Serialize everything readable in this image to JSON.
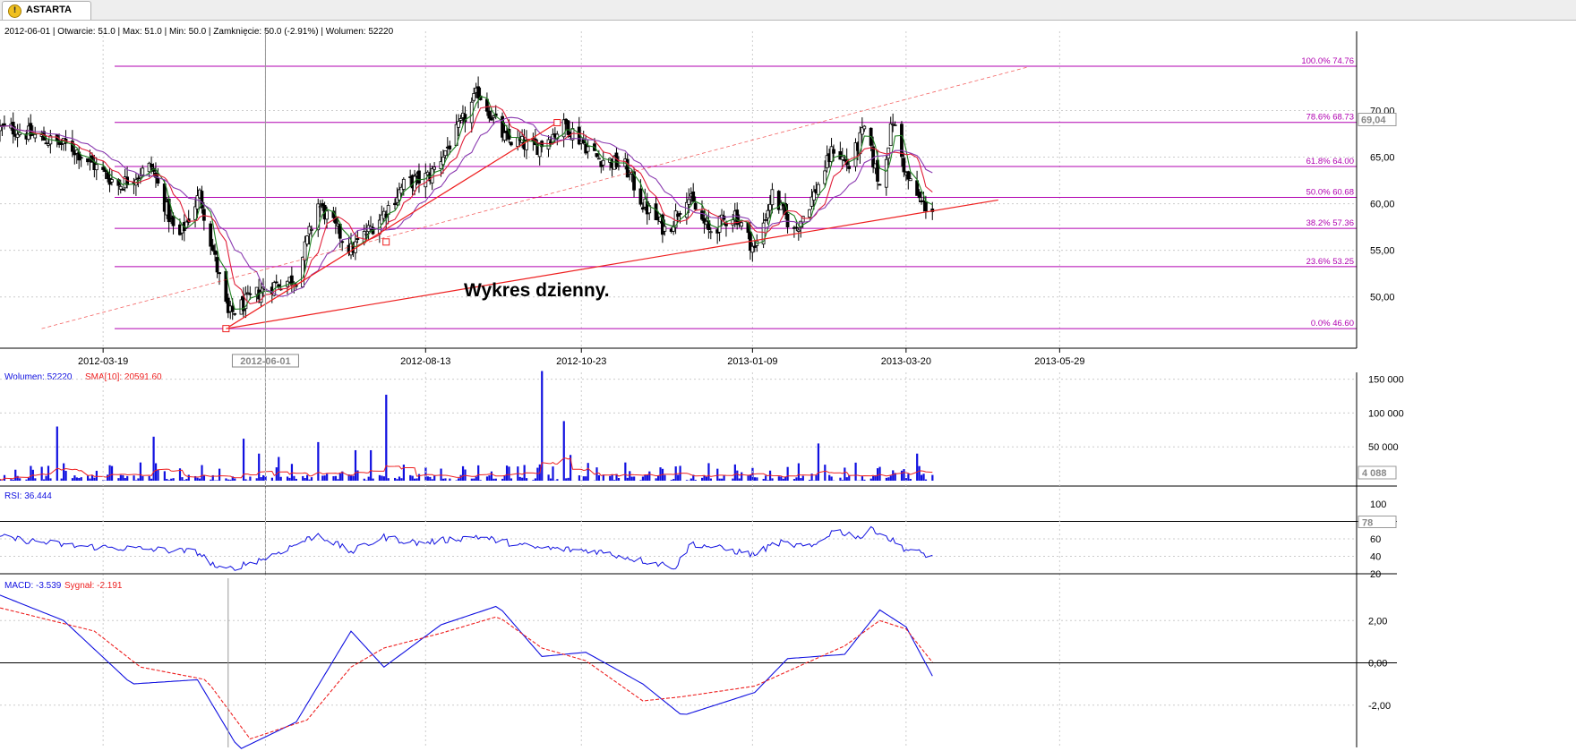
{
  "tab": {
    "label": "ASTARTA",
    "icon": "warning-icon"
  },
  "info_line": "2012-06-01 | Otwarcie: 51.0 | Max: 51.0 | Min: 50.0 | Zamknięcie: 50.0 (-2.91%) | Wolumen: 52220",
  "annotation": "Wykres dzienny.",
  "colors": {
    "candle": "#000000",
    "sma_fast": "#208020",
    "sma_mid": "#e0203a",
    "sma_slow": "#8a3ab0",
    "fib": "#b000b0",
    "trend": "#ee2020",
    "volume": "#1010e0",
    "rsi": "#1010e0",
    "macd": "#1010e0",
    "signal": "#ee2020"
  },
  "chart_data": [
    {
      "type": "candlestick",
      "panel": "price",
      "ylim": [
        44.5,
        78.5
      ],
      "xlim": [
        "2012-02-01",
        "2013-06-01"
      ],
      "x_ticks": [
        "2012-03-19",
        "2012-06-01",
        "2012-08-13",
        "2012-10-23",
        "2013-01-09",
        "2013-03-20",
        "2013-05-29"
      ],
      "y_ticks": [
        "50,00",
        "55,00",
        "60,00",
        "65,00",
        "70,00"
      ],
      "last_price_marker": "69,04",
      "fibonacci": [
        {
          "label": "100.0% 74.76",
          "value": 74.76
        },
        {
          "label": "78.6% 68.73",
          "value": 68.73
        },
        {
          "label": "61.8% 64.00",
          "value": 64.0
        },
        {
          "label": "50.0% 60.68",
          "value": 60.68
        },
        {
          "label": "38.2% 57.36",
          "value": 57.36
        },
        {
          "label": "23.6% 53.25",
          "value": 53.25
        },
        {
          "label": "0.0% 46.60",
          "value": 46.6
        }
      ],
      "trendlines": [
        {
          "from": [
            "2012-05-14",
            46.6
          ],
          "to": [
            "2012-10-12",
            68.7
          ],
          "handles": [
            [
              "2012-05-14",
              46.6
            ],
            [
              "2012-07-26",
              55.9
            ],
            [
              "2012-10-12",
              68.7
            ]
          ]
        },
        {
          "from": [
            "2012-05-14",
            46.6
          ],
          "to": [
            "2013-05-01",
            60.4
          ]
        },
        {
          "from": [
            "2012-02-20",
            46.6
          ],
          "to": [
            "2013-05-15",
            74.7
          ],
          "dashed": true
        }
      ],
      "anchors": [
        [
          "2012-02-07",
          68
        ],
        [
          "2012-03-05",
          66
        ],
        [
          "2012-03-26",
          62
        ],
        [
          "2012-04-10",
          64
        ],
        [
          "2012-04-22",
          56
        ],
        [
          "2012-05-02",
          61
        ],
        [
          "2012-05-15",
          48
        ],
        [
          "2012-06-01",
          51
        ],
        [
          "2012-06-15",
          52
        ],
        [
          "2012-06-25",
          60
        ],
        [
          "2012-07-10",
          55
        ],
        [
          "2012-07-25",
          59
        ],
        [
          "2012-08-03",
          62
        ],
        [
          "2012-08-15",
          63
        ],
        [
          "2012-08-28",
          68
        ],
        [
          "2012-09-06",
          72
        ],
        [
          "2012-09-18",
          67
        ],
        [
          "2012-10-02",
          66
        ],
        [
          "2012-10-16",
          68.5
        ],
        [
          "2012-10-30",
          65
        ],
        [
          "2012-11-12",
          64
        ],
        [
          "2012-11-20",
          60
        ],
        [
          "2012-12-01",
          57
        ],
        [
          "2012-12-10",
          61
        ],
        [
          "2012-12-20",
          57
        ],
        [
          "2013-01-01",
          59
        ],
        [
          "2013-01-10",
          55
        ],
        [
          "2013-01-18",
          61
        ],
        [
          "2013-01-28",
          57
        ],
        [
          "2013-02-06",
          61
        ],
        [
          "2013-02-15",
          66
        ],
        [
          "2013-02-22",
          64
        ],
        [
          "2013-03-01",
          68
        ],
        [
          "2013-03-08",
          62
        ],
        [
          "2013-03-14",
          69
        ],
        [
          "2013-03-20",
          63
        ],
        [
          "2013-03-27",
          60
        ],
        [
          "2013-04-01",
          59.5
        ]
      ]
    },
    {
      "type": "bar",
      "panel": "volume",
      "legend": [
        {
          "text": "Wolumen: 52220",
          "color": "#1010e0"
        },
        {
          "text": "SMA[10]: 20591.60",
          "color": "#ee2020"
        }
      ],
      "ylim": [
        0,
        160000
      ],
      "y_ticks": [
        "50 000",
        "100 000",
        "150 000"
      ],
      "last_marker": "4 088",
      "spikes": [
        [
          "2012-02-27",
          80000
        ],
        [
          "2012-04-11",
          65000
        ],
        [
          "2012-05-22",
          62000
        ],
        [
          "2012-05-29",
          40000
        ],
        [
          "2012-06-07",
          35000
        ],
        [
          "2012-06-25",
          57000
        ],
        [
          "2012-07-12",
          45000
        ],
        [
          "2012-07-26",
          127000
        ],
        [
          "2012-07-19",
          45000
        ],
        [
          "2012-10-05",
          162000
        ],
        [
          "2012-10-15",
          88000
        ],
        [
          "2012-10-18",
          38000
        ],
        [
          "2013-01-06",
          45000
        ],
        [
          "2013-02-08",
          55000
        ],
        [
          "2013-03-25",
          40000
        ]
      ]
    },
    {
      "type": "line",
      "panel": "rsi",
      "legend": [
        {
          "text": "RSI: 36.444",
          "color": "#1010e0"
        }
      ],
      "ylim": [
        20,
        100
      ],
      "y_ticks": [
        "20",
        "40",
        "60",
        "80",
        "100"
      ],
      "last_marker": "78",
      "anchors": [
        [
          "2012-02-01",
          62
        ],
        [
          "2012-03-05",
          52
        ],
        [
          "2012-04-10",
          48
        ],
        [
          "2012-05-01",
          45
        ],
        [
          "2012-05-12",
          23
        ],
        [
          "2012-06-01",
          38
        ],
        [
          "2012-06-25",
          65
        ],
        [
          "2012-07-10",
          45
        ],
        [
          "2012-07-25",
          62
        ],
        [
          "2012-08-10",
          55
        ],
        [
          "2012-09-05",
          63
        ],
        [
          "2012-10-01",
          50
        ],
        [
          "2012-10-30",
          46
        ],
        [
          "2012-11-20",
          35
        ],
        [
          "2012-12-05",
          28
        ],
        [
          "2012-12-12",
          55
        ],
        [
          "2013-01-10",
          42
        ],
        [
          "2013-01-20",
          56
        ],
        [
          "2013-02-05",
          50
        ],
        [
          "2013-02-15",
          70
        ],
        [
          "2013-02-28",
          62
        ],
        [
          "2013-03-05",
          72
        ],
        [
          "2013-03-20",
          48
        ],
        [
          "2013-04-01",
          40
        ]
      ]
    },
    {
      "type": "line",
      "panel": "macd",
      "legend": [
        {
          "text": "MACD: -3.539",
          "color": "#1010e0"
        },
        {
          "text": "Sygnał: -2.191",
          "color": "#ee2020"
        }
      ],
      "ylim": [
        -4,
        4
      ],
      "y_ticks": [
        "-2,00",
        "0,00",
        "2,00"
      ],
      "series": [
        {
          "color": "#1010e0",
          "anchors": [
            [
              "2012-02-01",
              3.2
            ],
            [
              "2012-03-01",
              2
            ],
            [
              "2012-04-01",
              -1
            ],
            [
              "2012-05-01",
              -0.8
            ],
            [
              "2012-05-20",
              -4.1
            ],
            [
              "2012-06-15",
              -2.8
            ],
            [
              "2012-07-10",
              1.5
            ],
            [
              "2012-07-25",
              -0.2
            ],
            [
              "2012-08-20",
              1.8
            ],
            [
              "2012-09-15",
              2.7
            ],
            [
              "2012-10-05",
              0.3
            ],
            [
              "2012-10-25",
              0.5
            ],
            [
              "2012-11-20",
              -1
            ],
            [
              "2012-12-08",
              -2.5
            ],
            [
              "2013-01-10",
              -1.4
            ],
            [
              "2013-01-25",
              0.2
            ],
            [
              "2013-02-20",
              0.4
            ],
            [
              "2013-03-08",
              2.5
            ],
            [
              "2013-03-20",
              1.7
            ],
            [
              "2013-04-05",
              -1.4
            ]
          ]
        },
        {
          "color": "#ee2020",
          "dashed": true,
          "anchors": [
            [
              "2012-02-01",
              2.6
            ],
            [
              "2012-03-15",
              1.5
            ],
            [
              "2012-04-05",
              -0.2
            ],
            [
              "2012-05-05",
              -0.8
            ],
            [
              "2012-05-25",
              -3.6
            ],
            [
              "2012-06-20",
              -2.7
            ],
            [
              "2012-07-10",
              -0.2
            ],
            [
              "2012-07-25",
              0.7
            ],
            [
              "2012-08-20",
              1.4
            ],
            [
              "2012-09-15",
              2.2
            ],
            [
              "2012-10-05",
              0.7
            ],
            [
              "2012-10-25",
              0.1
            ],
            [
              "2012-11-20",
              -1.8
            ],
            [
              "2012-12-08",
              -1.6
            ],
            [
              "2013-01-10",
              -1.1
            ],
            [
              "2013-01-25",
              -0.4
            ],
            [
              "2013-02-20",
              0.8
            ],
            [
              "2013-03-08",
              2
            ],
            [
              "2013-03-20",
              1.6
            ],
            [
              "2013-04-05",
              -0.5
            ]
          ]
        }
      ]
    }
  ]
}
